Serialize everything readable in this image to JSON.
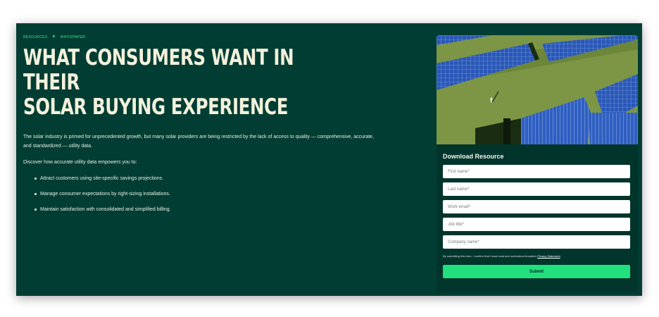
{
  "breadcrumb": {
    "section": "RESOURCES",
    "separator": "✦",
    "type": "WHITEPAPER"
  },
  "hero": {
    "title_line1": "WHAT CONSUMERS WANT IN THEIR",
    "title_line2": "SOLAR BUYING EXPERIENCE",
    "intro": "The solar industry is primed for unprecedented growth, but many solar providers are being restricted by the lack of access to quality — comprehensive, accurate, and standardized — utility data.",
    "discover": "Discover how accurate utility data empowers you to:",
    "bullets": [
      "Attract customers using site-specific savings projections.",
      "Manage consumer expectations by right-sizing installations.",
      "Maintain satisfaction with consolidated and simplified billing."
    ]
  },
  "form": {
    "title": "Download Resource",
    "fields": [
      {
        "placeholder": "First name*"
      },
      {
        "placeholder": "Last name*"
      },
      {
        "placeholder": "Work email*"
      },
      {
        "placeholder": "Job title*"
      },
      {
        "placeholder": "Company name*"
      }
    ],
    "consent_prefix": "By submitting this form, I confirm that I have read and understood Arcadia's",
    "consent_link": "Privacy Statement",
    "consent_suffix": ".",
    "submit_label": "Submit"
  },
  "colors": {
    "background": "#023d33",
    "accent": "#3ee88b",
    "button": "#22e07c",
    "title": "#f3f1dc"
  },
  "image": {
    "subject": "solar-panel-field-photo"
  }
}
